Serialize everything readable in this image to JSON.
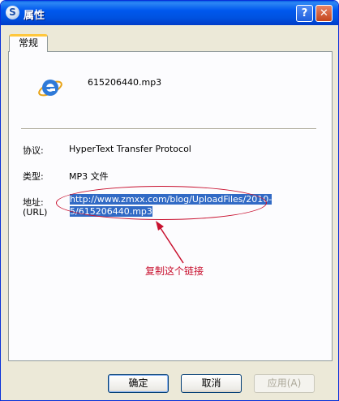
{
  "window": {
    "title": "属性"
  },
  "tabs": [
    {
      "label": "常规"
    }
  ],
  "file": {
    "icon": "ie-icon",
    "name": "615206440.mp3"
  },
  "properties": {
    "protocol": {
      "label": "协议:",
      "value": "HyperText Transfer Protocol"
    },
    "type": {
      "label": "类型:",
      "value": "MP3 文件"
    },
    "address": {
      "label": "地址:",
      "sublabel": "(URL)",
      "url_line1": "http://www.zmxx.com/blog/UploadFiles/2010-",
      "url_line2": "5/615206440.mp3"
    }
  },
  "annotation": {
    "text": "复制这个链接",
    "color": "#c8102e"
  },
  "buttons": {
    "ok": "确定",
    "cancel": "取消",
    "apply": "应用(A)"
  },
  "colors": {
    "titlebar": "#0058ee",
    "selection": "#316ac5",
    "dialog": "#ece9d8"
  }
}
